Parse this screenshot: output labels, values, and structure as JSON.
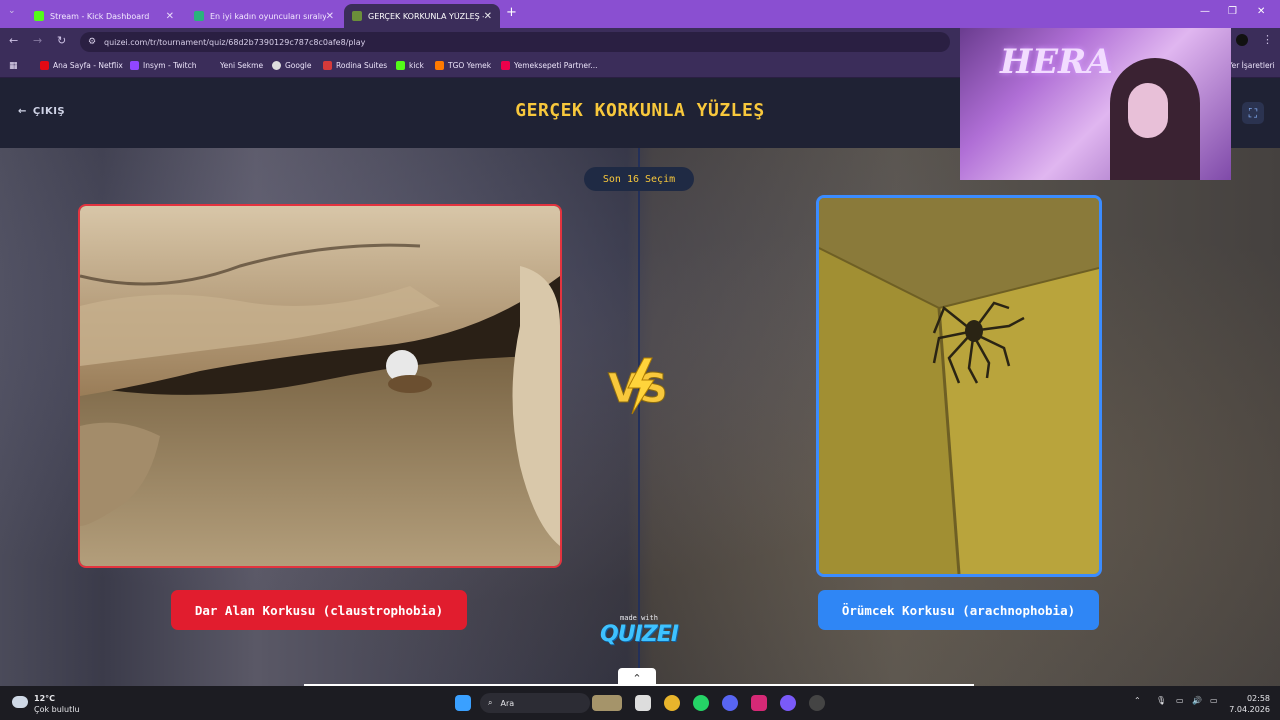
{
  "browser": {
    "tabs": [
      {
        "title": "Stream - Kick Dashboard",
        "favicon_color": "#53fc18",
        "active": false
      },
      {
        "title": "En iyi kadın oyuncuları sıralıyor",
        "favicon_color": "#2ab37c",
        "active": false
      },
      {
        "title": "GERÇEK KORKUNLA YÜZLEŞ - T",
        "favicon_color": "#6b8f3a",
        "active": true
      }
    ],
    "new_tab": "+",
    "url": "quizei.com/tr/tournament/quiz/68d2b7390129c787c8c0afe8/play",
    "bookmarks": [
      {
        "label": "Ana Sayfa - Netflix",
        "color": "#e50914"
      },
      {
        "label": "Insym - Twitch",
        "color": "#9146ff"
      },
      {
        "label": "Yeni Sekme",
        "color": "#3b2d5a"
      },
      {
        "label": "Google",
        "color": "#cccccc"
      },
      {
        "label": "Rodina Suites",
        "color": "#d63a3a"
      },
      {
        "label": "kick",
        "color": "#53fc18"
      },
      {
        "label": "TGO Yemek",
        "color": "#ff7a00"
      },
      {
        "label": "Yemeksepeti Partner...",
        "color": "#ea004b"
      }
    ],
    "bookmarks_right": "Yer İşaretleri"
  },
  "page": {
    "exit_label": "ÇIKIŞ",
    "title": "GERÇEK KORKUNLA YÜZLEŞ",
    "round_label": "Son 16 Seçim",
    "vs_label": "VS",
    "left_option": "Dar Alan Korkusu (claustrophobia)",
    "right_option": "Örümcek Korkusu (arachnophobia)",
    "made_with": "made with",
    "brand": "QUIZEI",
    "colors": {
      "title": "#f8c83c",
      "left": "#e11d2e",
      "right": "#2f86f5"
    }
  },
  "webcam": {
    "overlay_text": "HERA"
  },
  "taskbar": {
    "weather_temp": "12°C",
    "weather_desc": "Çok bulutlu",
    "search_placeholder": "Ara",
    "time": "02:58",
    "date": "7.04.2026"
  }
}
